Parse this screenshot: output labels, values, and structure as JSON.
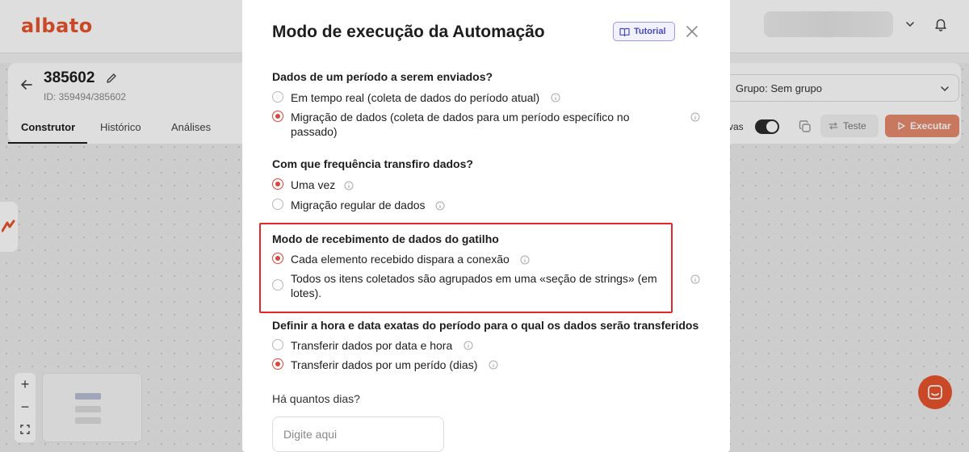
{
  "app": {
    "logo": "albato",
    "automation_name": "385602",
    "automation_id": "ID: 359494/385602",
    "tabs": [
      {
        "label": "Construtor",
        "active": true
      },
      {
        "label": "Histórico",
        "active": false
      },
      {
        "label": "Análises",
        "active": false
      }
    ],
    "group_select": "Grupo: Sem grupo",
    "toggle_label": "vas",
    "test_button": "Teste",
    "execute_button": "Executar",
    "zoom_in": "+",
    "zoom_out": "−",
    "brand_color": "#e8532c"
  },
  "modal": {
    "title": "Modo de execução da Automação",
    "tutorial_button": "Tutorial",
    "sections": [
      {
        "title": "Dados de um período a serem enviados?",
        "options": [
          {
            "label": "Em tempo real (coleta de dados do período atual)",
            "selected": false
          },
          {
            "label": "Migração de dados (coleta de dados para um período específico no",
            "label_line2": "passado)",
            "selected": true
          }
        ]
      },
      {
        "title": "Com que frequência transfiro dados?",
        "options": [
          {
            "label": "Uma vez",
            "selected": true
          },
          {
            "label": "Migração regular de dados",
            "selected": false
          }
        ]
      },
      {
        "title": "Modo de recebimento de dados do gatilho",
        "options": [
          {
            "label": "Cada elemento recebido dispara a conexão",
            "selected": true
          },
          {
            "label": "Todos os itens coletados são agrupados em uma «seção de strings» (em",
            "label_line2": "lotes).",
            "selected": false
          }
        ]
      },
      {
        "title": "Definir a hora e data exatas do período para o qual os dados serão transferidos",
        "options": [
          {
            "label": "Transferir dados por data e hora",
            "selected": false
          },
          {
            "label": "Transferir dados por um perído (dias)",
            "selected": true
          }
        ]
      }
    ],
    "days_question": "Há quantos dias?",
    "days_input": {
      "value": "",
      "placeholder": "Digite aqui"
    },
    "accent_color": "#e0453a",
    "highlight_color": "#e5262b"
  }
}
